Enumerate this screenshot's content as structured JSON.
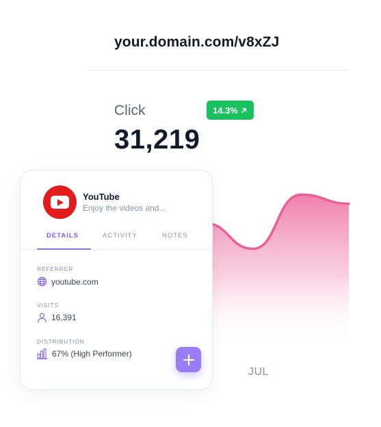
{
  "link": {
    "domain": "your.domain.com/v8xZJ"
  },
  "metric": {
    "label": "Click",
    "value": "31,219",
    "change": "14.3%",
    "change_icon": "arrow-up-right-icon",
    "change_color": "#18c25f"
  },
  "chart_data": {
    "type": "area",
    "x_ticks": [
      "JUL"
    ],
    "color": "#e8609a",
    "series": [
      {
        "values": [
          0.74,
          0.79,
          0.62,
          0.98,
          0.92
        ]
      }
    ],
    "ylim": [
      0,
      1
    ]
  },
  "card": {
    "source": {
      "name": "YouTube",
      "description": "Enjoy the videos and...",
      "logo_icon": "youtube-play-icon",
      "logo_color": "#e11d1d"
    },
    "tabs": [
      {
        "label": "DETAILS",
        "active": true
      },
      {
        "label": "ACTIVITY",
        "active": false
      },
      {
        "label": "NOTES",
        "active": false
      }
    ],
    "referrer": {
      "label": "REFERRER",
      "value": "youtube.com",
      "icon": "globe-icon"
    },
    "visits": {
      "label": "VISITS",
      "value": "16,391",
      "icon": "user-icon"
    },
    "distribution": {
      "label": "DISTRIBUTION",
      "value": "67% (High Performer)",
      "icon": "bar-chart-icon"
    },
    "add_button": {
      "icon": "plus-icon",
      "color": "#9b7cf8"
    }
  }
}
